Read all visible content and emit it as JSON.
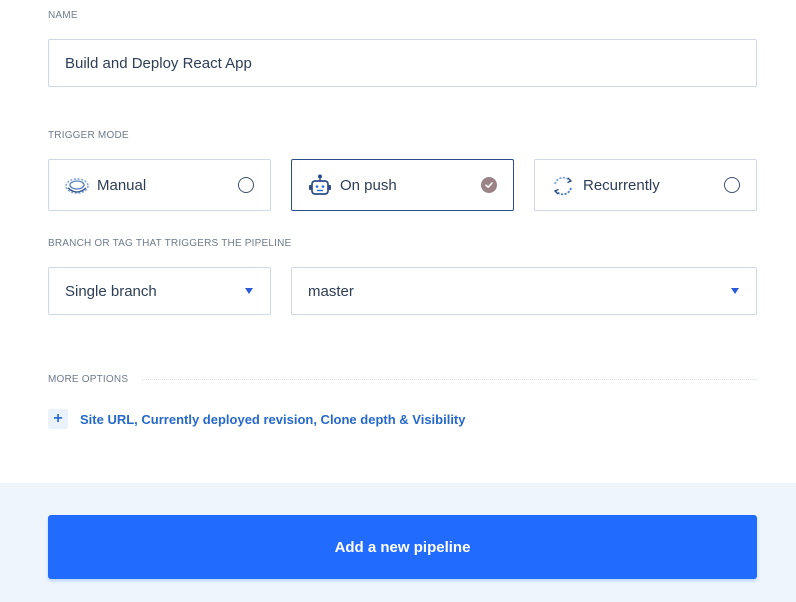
{
  "name_section": {
    "label": "NAME",
    "value": "Build and Deploy React App"
  },
  "trigger_section": {
    "label": "TRIGGER MODE",
    "options": [
      {
        "label": "Manual",
        "icon": "manual-icon",
        "selected": false
      },
      {
        "label": "On push",
        "icon": "robot-icon",
        "selected": true
      },
      {
        "label": "Recurrently",
        "icon": "recurring-icon",
        "selected": false
      }
    ]
  },
  "branch_section": {
    "label": "BRANCH OR TAG THAT TRIGGERS THE PIPELINE",
    "scope_value": "Single branch",
    "branch_value": "master"
  },
  "more_options": {
    "label": "MORE OPTIONS",
    "link_text": "Site URL, Currently deployed revision, Clone depth & Visibility"
  },
  "footer": {
    "submit_label": "Add a new pipeline"
  },
  "colors": {
    "accent": "#226bff",
    "link": "#2769c8",
    "selected_border": "#2c4d8a",
    "radio_checked": "#9b8287",
    "footer_bg": "#eef6fc"
  }
}
